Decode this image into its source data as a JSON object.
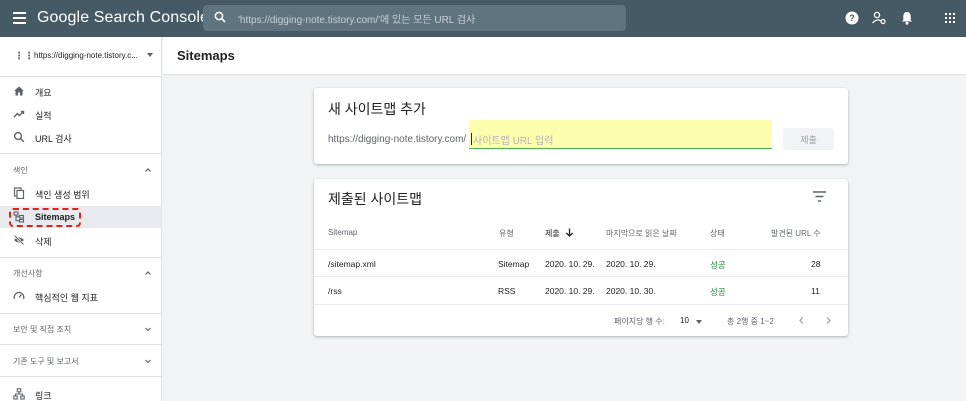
{
  "topbar": {
    "app_title": "Google Search Console",
    "search_placeholder": "'https://digging-note.tistory.com/'에 있는 모든 URL 검사",
    "icons": [
      "help-icon",
      "account-settings-icon",
      "notifications-icon",
      "apps-grid-icon"
    ]
  },
  "sidebar": {
    "property": "https://digging-note.tistory.c...",
    "items_top": [
      {
        "label": "개요",
        "icon": "home-icon"
      },
      {
        "label": "실적",
        "icon": "trending-icon"
      },
      {
        "label": "URL 검사",
        "icon": "search-icon"
      }
    ],
    "section_index": "색인",
    "items_index": [
      {
        "label": "색인 생성 범위",
        "icon": "copy-icon"
      },
      {
        "label": "Sitemaps",
        "icon": "sitemap-icon"
      },
      {
        "label": "삭제",
        "icon": "eye-off-icon"
      }
    ],
    "section_enhance": "개선사항",
    "items_enhance": [
      {
        "label": "핵심적인 웹 지표",
        "icon": "gauge-icon"
      }
    ],
    "section_security": "보안 및 직접 조치",
    "section_legacy": "기존 도구 및 보고서",
    "item_links": {
      "label": "링크",
      "icon": "links-icon"
    }
  },
  "page": {
    "title": "Sitemaps"
  },
  "add_card": {
    "title": "새 사이트맵 추가",
    "prefix": "https://digging-note.tistory.com/",
    "input_placeholder": "사이트맵 URL 입력",
    "submit_label": "제출"
  },
  "submitted_card": {
    "title": "제출된 사이트맵",
    "headers": {
      "sitemap": "Sitemap",
      "type": "유형",
      "submitted": "제출",
      "last_read": "마지막으로 읽은 날짜",
      "status": "상태",
      "urls": "발견된 URL 수"
    },
    "rows": [
      {
        "sitemap": "/sitemap.xml",
        "type": "Sitemap",
        "submitted": "2020. 10. 29.",
        "last_read": "2020. 10. 29.",
        "status": "성공",
        "urls": "28"
      },
      {
        "sitemap": "/rss",
        "type": "RSS",
        "submitted": "2020. 10. 29.",
        "last_read": "2020. 10. 30.",
        "status": "성공",
        "urls": "11"
      }
    ],
    "pager": {
      "rows_per_page_label": "페이지당 행 수:",
      "rows_per_page": "10",
      "range": "총 2행 중 1~2"
    }
  },
  "colors": {
    "topbar": "#455a64",
    "success": "#1e8e3e",
    "highlight_input": "#fdfdae",
    "annotation": "#e0201f"
  }
}
